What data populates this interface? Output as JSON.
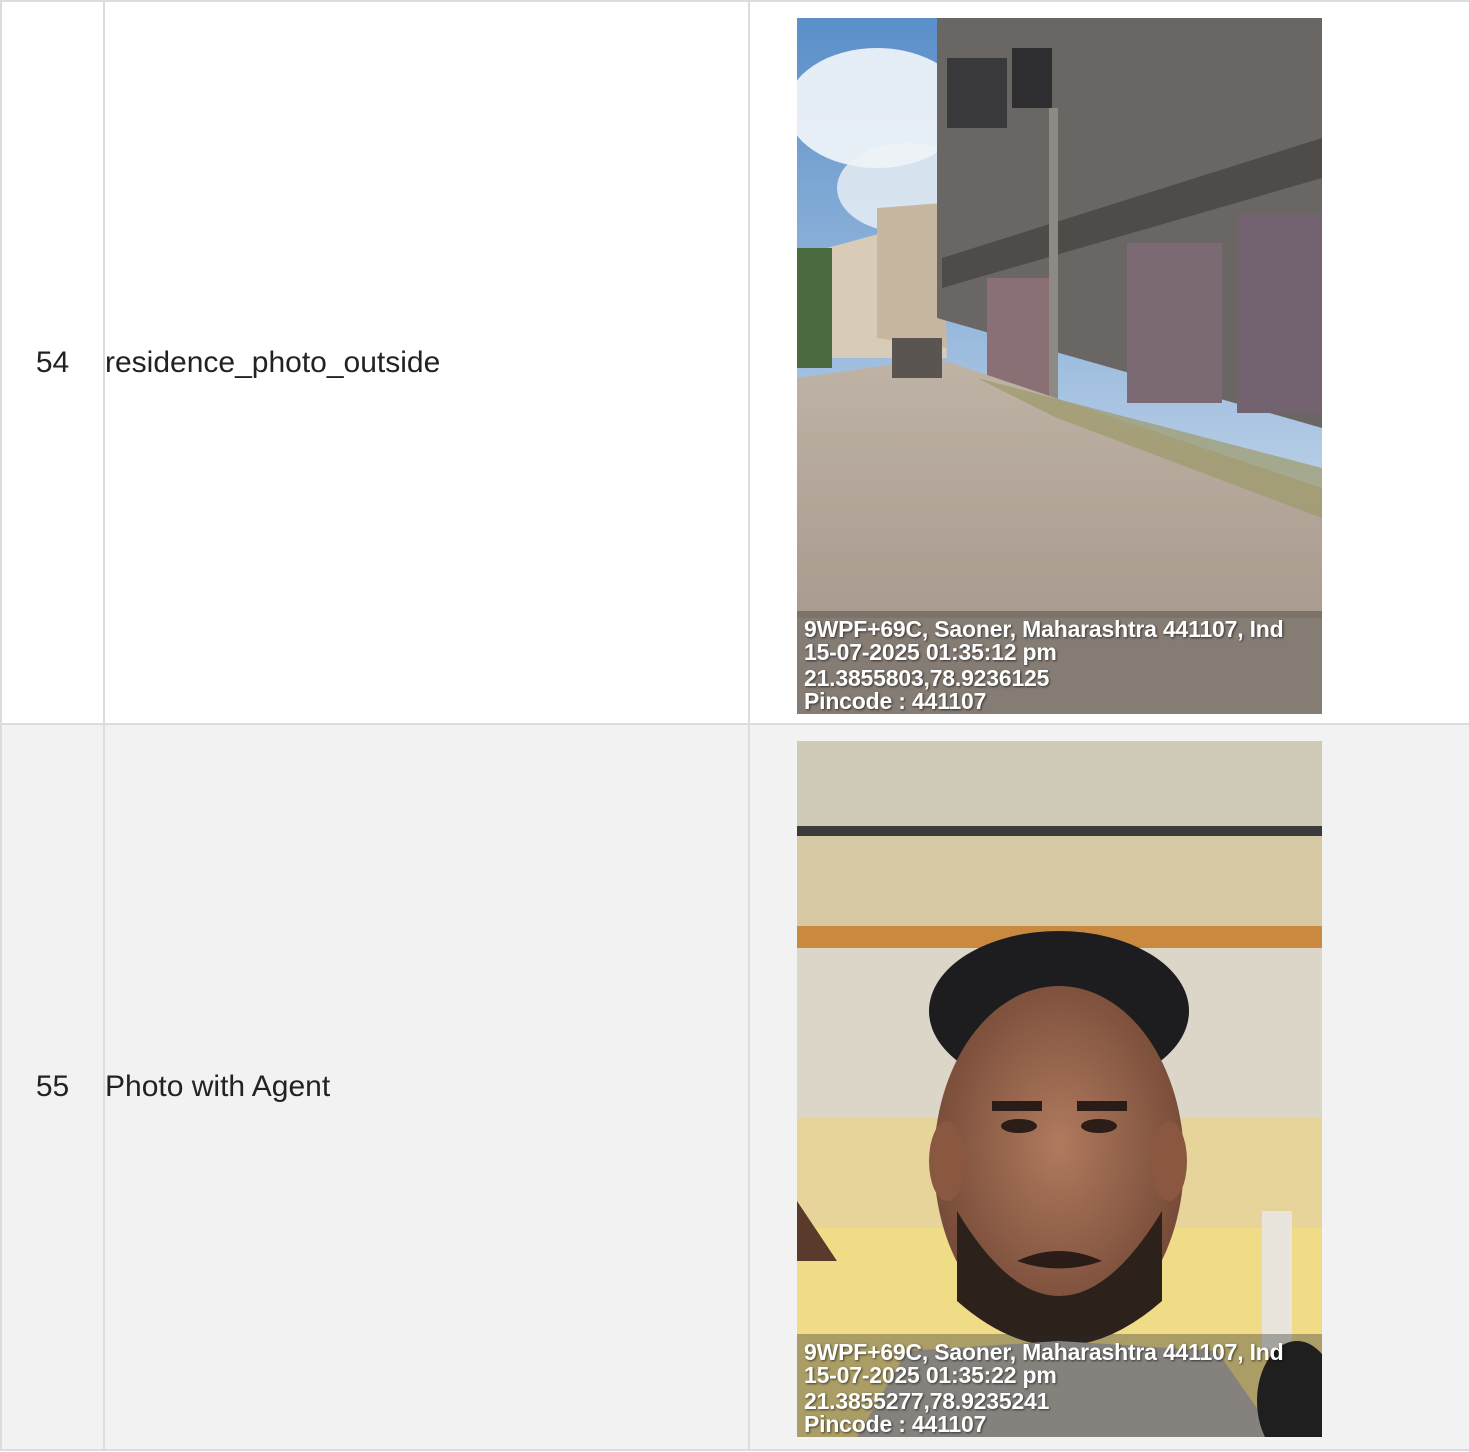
{
  "rows": [
    {
      "number": "54",
      "label": "residence_photo_outside",
      "photo_subject": "street-with-shuttered-shops",
      "stamp": {
        "address": "9WPF+69C, Saoner, Maharashtra 441107, Ind",
        "datetime": "15-07-2025 01:35:12 pm",
        "coords": "21.3855803,78.9236125",
        "pincode": "Pincode : 441107"
      }
    },
    {
      "number": "55",
      "label": "Photo with Agent",
      "photo_subject": "agent-selfie",
      "stamp": {
        "address": "9WPF+69C, Saoner, Maharashtra 441107, Ind",
        "datetime": "15-07-2025 01:35:22 pm",
        "coords": "21.3855277,78.9235241",
        "pincode": "Pincode : 441107"
      }
    }
  ]
}
